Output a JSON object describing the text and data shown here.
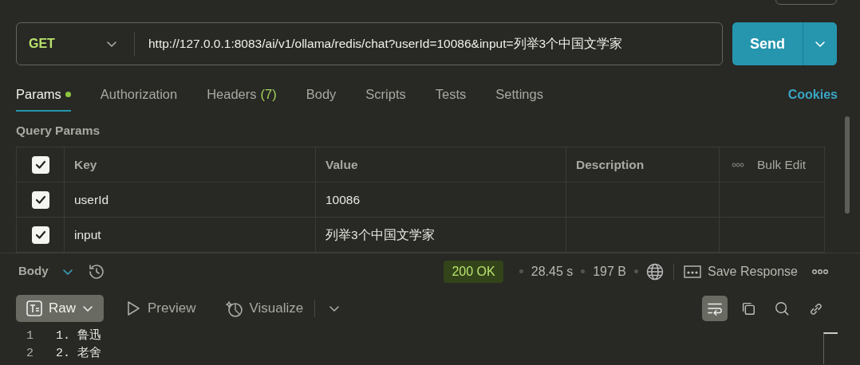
{
  "request": {
    "method": "GET",
    "url": "http://127.0.0.1:8083/ai/v1/ollama/redis/chat?userId=10086&input=列举3个中国文学家",
    "send_label": "Send"
  },
  "tabs": [
    {
      "label": "Params",
      "dot": true,
      "selected": true
    },
    {
      "label": "Authorization",
      "dot": false,
      "selected": false
    },
    {
      "label": "Headers",
      "count": "(7)",
      "dot": false,
      "selected": false
    },
    {
      "label": "Body",
      "dot": false,
      "selected": false
    },
    {
      "label": "Scripts",
      "dot": false,
      "selected": false
    },
    {
      "label": "Tests",
      "dot": false,
      "selected": false
    },
    {
      "label": "Settings",
      "dot": false,
      "selected": false
    }
  ],
  "cookies_link": "Cookies",
  "query_params": {
    "title": "Query Params",
    "all_checked": true,
    "columns": [
      "Key",
      "Value",
      "Description"
    ],
    "bulk_edit": "Bulk Edit",
    "rows": [
      {
        "checked": true,
        "key": "userId",
        "value": "10086"
      },
      {
        "checked": true,
        "key": "input",
        "value": "列举3个中国文学家"
      }
    ]
  },
  "response": {
    "section": "Body",
    "status": "200 OK",
    "time": "28.45 s",
    "size": "197 B",
    "save": "Save Response",
    "views": [
      {
        "label": "Raw",
        "kind": "raw",
        "selected": true
      },
      {
        "label": "Preview",
        "kind": "preview",
        "selected": false
      },
      {
        "label": "Visualize",
        "kind": "visualize",
        "selected": false
      }
    ],
    "wrap_on": true,
    "lines": [
      {
        "number": "1",
        "text": "1. 鲁迅"
      },
      {
        "number": "2",
        "text": "2. 老舍"
      }
    ]
  }
}
